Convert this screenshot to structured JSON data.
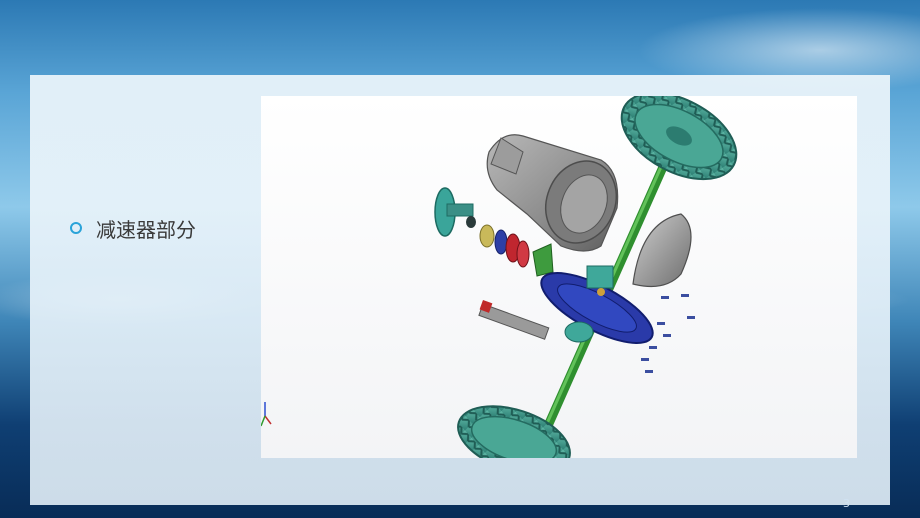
{
  "slide": {
    "heading": "减速器部分",
    "page_number": "3"
  },
  "cad_view": {
    "caption": "",
    "image_alt": "减速器部分"
  }
}
